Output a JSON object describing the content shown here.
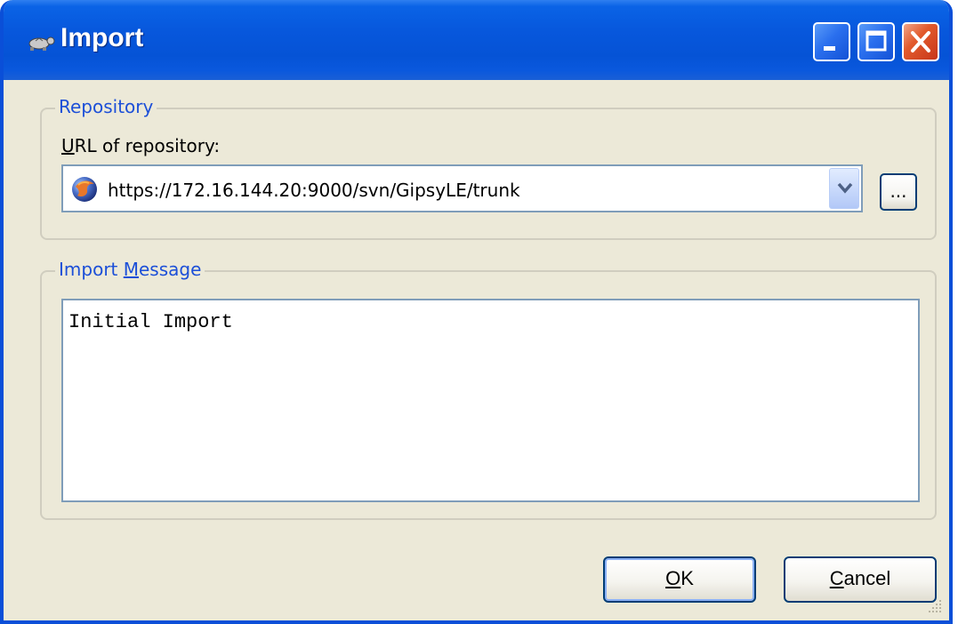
{
  "window": {
    "title": "Import",
    "app_icon": "tortoise-svn-icon",
    "controls": {
      "minimize_icon": "minimize-icon",
      "maximize_icon": "maximize-icon",
      "close_icon": "close-icon"
    },
    "colors": {
      "titlebar": "#0553d6",
      "face": "#ece9d8",
      "group_label": "#1c4fd8",
      "close_button": "#e25a2c"
    }
  },
  "repository": {
    "group_label": "Repository",
    "url_label_mnemonic": "U",
    "url_label_rest": "RL of repository:",
    "url_value": "https://172.16.144.20:9000/svn/GipsyLE/trunk",
    "url_icon": "globe-icon",
    "dropdown_icon": "chevron-down-icon",
    "browse_label": "..."
  },
  "import_message": {
    "group_label_prefix": "Import ",
    "group_label_mnemonic": "M",
    "group_label_rest": "essage",
    "text": "Initial Import"
  },
  "buttons": {
    "ok_mnemonic": "O",
    "ok_rest": "K",
    "cancel_mnemonic": "C",
    "cancel_rest": "ancel"
  }
}
